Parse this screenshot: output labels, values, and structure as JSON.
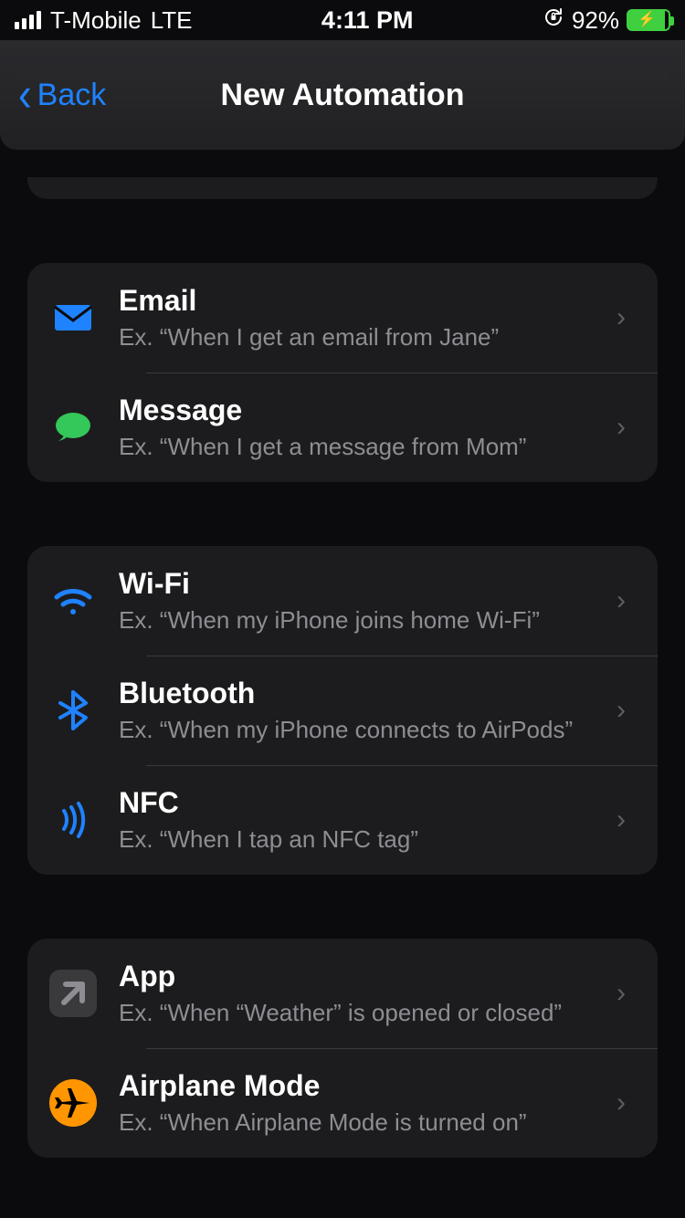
{
  "status": {
    "carrier": "T-Mobile",
    "network": "LTE",
    "time": "4:11 PM",
    "battery_pct": "92%",
    "battery_fill": "92%"
  },
  "nav": {
    "back_label": "Back",
    "title": "New Automation"
  },
  "groups": [
    {
      "rows": [
        {
          "icon": "email-icon",
          "title": "Email",
          "subtitle": "Ex. “When I get an email from Jane”"
        },
        {
          "icon": "message-icon",
          "title": "Message",
          "subtitle": "Ex. “When I get a message from Mom”"
        }
      ]
    },
    {
      "rows": [
        {
          "icon": "wifi-icon",
          "title": "Wi-Fi",
          "subtitle": "Ex. “When my iPhone joins home Wi-Fi”"
        },
        {
          "icon": "bluetooth-icon",
          "title": "Bluetooth",
          "subtitle": "Ex. “When my iPhone connects to AirPods”"
        },
        {
          "icon": "nfc-icon",
          "title": "NFC",
          "subtitle": "Ex. “When I tap an NFC tag”"
        }
      ]
    },
    {
      "rows": [
        {
          "icon": "app-icon",
          "title": "App",
          "subtitle": "Ex. “When “Weather” is opened or closed”"
        },
        {
          "icon": "airplane-mode-icon",
          "title": "Airplane Mode",
          "subtitle": "Ex. “When Airplane Mode is turned on”"
        }
      ]
    }
  ]
}
